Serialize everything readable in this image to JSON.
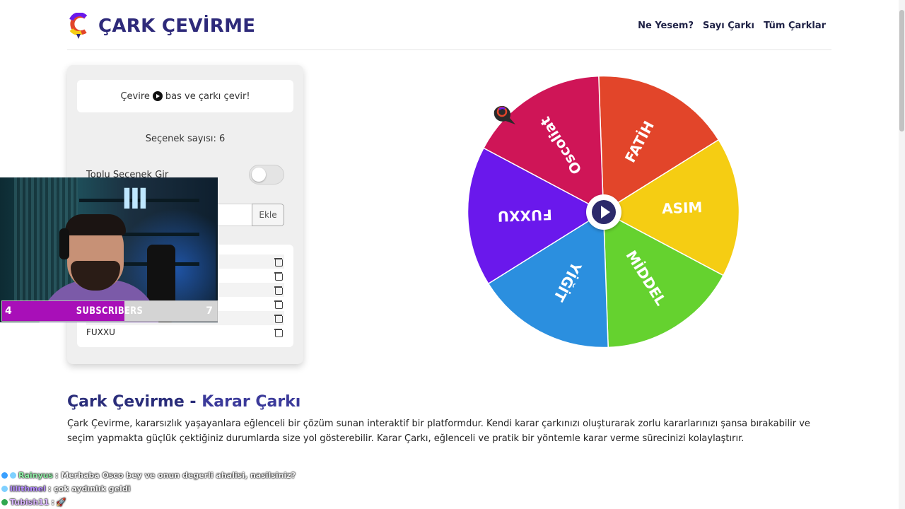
{
  "header": {
    "logo_text": "ÇARK ÇEVİRME",
    "nav": [
      "Ne Yesem?",
      "Sayı Çarkı",
      "Tüm Çarklar"
    ]
  },
  "panel": {
    "instruction_pre": "Çevire",
    "instruction_post": "bas ve çarkı çevir!",
    "option_count": "Seçenek sayısı: 6",
    "bulk_label": "Toplu Seçenek Gir",
    "bulk_enabled": false,
    "add_button": "Ekle",
    "visible_list_item": "FUXXU"
  },
  "wheel": {
    "segments": [
      {
        "label": "FATİH",
        "color": "#e2452a"
      },
      {
        "label": "ASIM",
        "color": "#f5cd13"
      },
      {
        "label": "MİDDEL",
        "color": "#65d22f"
      },
      {
        "label": "YİĞİT",
        "color": "#2b8fdf"
      },
      {
        "label": "FUXXU",
        "color": "#6a18ec"
      },
      {
        "label": "Oscoliat",
        "color": "#cf1557"
      }
    ]
  },
  "overlay": {
    "subscribers_label": "SUBSCRIBERS",
    "subscribers_start": "4",
    "subscribers_goal": "7",
    "progress_fraction": 0.57
  },
  "article": {
    "title_part1": "Çark Çevirme - ",
    "title_part2": "Karar Çarkı",
    "paragraph": "Çark Çevirme, kararsızlık yaşayanlara eğlenceli bir çözüm sunan interaktif bir platformdur. Kendi karar çarkınızı oluşturarak zorlu kararlarınızı şansa bırakabilir ve seçim yapmakta güçlük çektiğiniz durumlarda size yol gösterebilir. Karar Çarkı, eğlenceli ve pratik bir yöntemle karar verme sürecinizi kolaylaştırır."
  },
  "chat": [
    {
      "user": "Rainyus",
      "message": ": Merhaba Osco bey ve onun degerli ahalisi, nasilsiniz?"
    },
    {
      "user": "lilithmel",
      "message": ": çok aydınlık geldi"
    },
    {
      "user": "Tubish11",
      "message": ":"
    }
  ]
}
